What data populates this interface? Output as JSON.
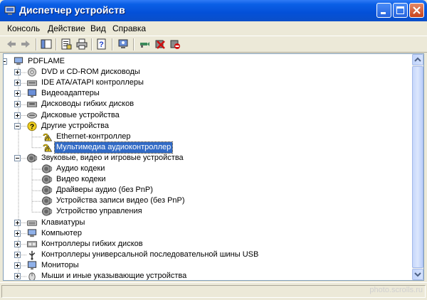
{
  "window": {
    "title": "Диспетчер устройств"
  },
  "menu": [
    "Консоль",
    "Действие",
    "Вид",
    "Справка"
  ],
  "tree": [
    {
      "label": "PDFLAME",
      "icon": "computer-icon",
      "level": 0,
      "expander": "minus"
    },
    {
      "label": "DVD и CD-ROM дисководы",
      "icon": "cdrom-icon",
      "level": 1,
      "expander": "plus"
    },
    {
      "label": "IDE ATA/ATAPI контроллеры",
      "icon": "ide-controller-icon",
      "level": 1,
      "expander": "plus"
    },
    {
      "label": "Видеоадаптеры",
      "icon": "display-adapter-icon",
      "level": 1,
      "expander": "plus"
    },
    {
      "label": "Дисководы гибких дисков",
      "icon": "floppy-drive-icon",
      "level": 1,
      "expander": "plus"
    },
    {
      "label": "Дисковые устройства",
      "icon": "disk-drive-icon",
      "level": 1,
      "expander": "plus"
    },
    {
      "label": "Другие устройства",
      "icon": "unknown-device-icon",
      "level": 1,
      "expander": "minus"
    },
    {
      "label": "Ethernet-контроллер",
      "icon": "unknown-device-warning-icon",
      "level": 2
    },
    {
      "label": "Мультимедиа аудиоконтроллер",
      "icon": "unknown-device-warning-icon",
      "level": 2,
      "selected": true
    },
    {
      "label": "Звуковые, видео и игровые устройства",
      "icon": "sound-device-icon",
      "level": 1,
      "expander": "minus"
    },
    {
      "label": "Аудио кодеки",
      "icon": "sound-device-icon",
      "level": 2
    },
    {
      "label": "Видео кодеки",
      "icon": "sound-device-icon",
      "level": 2
    },
    {
      "label": "Драйверы аудио (без PnP)",
      "icon": "sound-device-icon",
      "level": 2
    },
    {
      "label": "Устройства записи видео (без PnP)",
      "icon": "sound-device-icon",
      "level": 2
    },
    {
      "label": "Устройство управления",
      "icon": "sound-device-icon",
      "level": 2
    },
    {
      "label": "Клавиатуры",
      "icon": "keyboard-icon",
      "level": 1,
      "expander": "plus"
    },
    {
      "label": "Компьютер",
      "icon": "computer-icon",
      "level": 1,
      "expander": "plus"
    },
    {
      "label": "Контроллеры гибких дисков",
      "icon": "floppy-controller-icon",
      "level": 1,
      "expander": "plus"
    },
    {
      "label": "Контроллеры универсальной последовательной шины USB",
      "icon": "usb-icon",
      "level": 1,
      "expander": "plus"
    },
    {
      "label": "Мониторы",
      "icon": "monitor-icon",
      "level": 1,
      "expander": "plus"
    },
    {
      "label": "Мыши и иные указывающие устройства",
      "icon": "mouse-icon",
      "level": 1,
      "expander": "plus"
    }
  ],
  "watermark": "photo.scrolls.ru",
  "colors": {
    "title_bar": "#0a5fe6",
    "selection": "#316ac5",
    "tree_border": "#7f9db9"
  }
}
